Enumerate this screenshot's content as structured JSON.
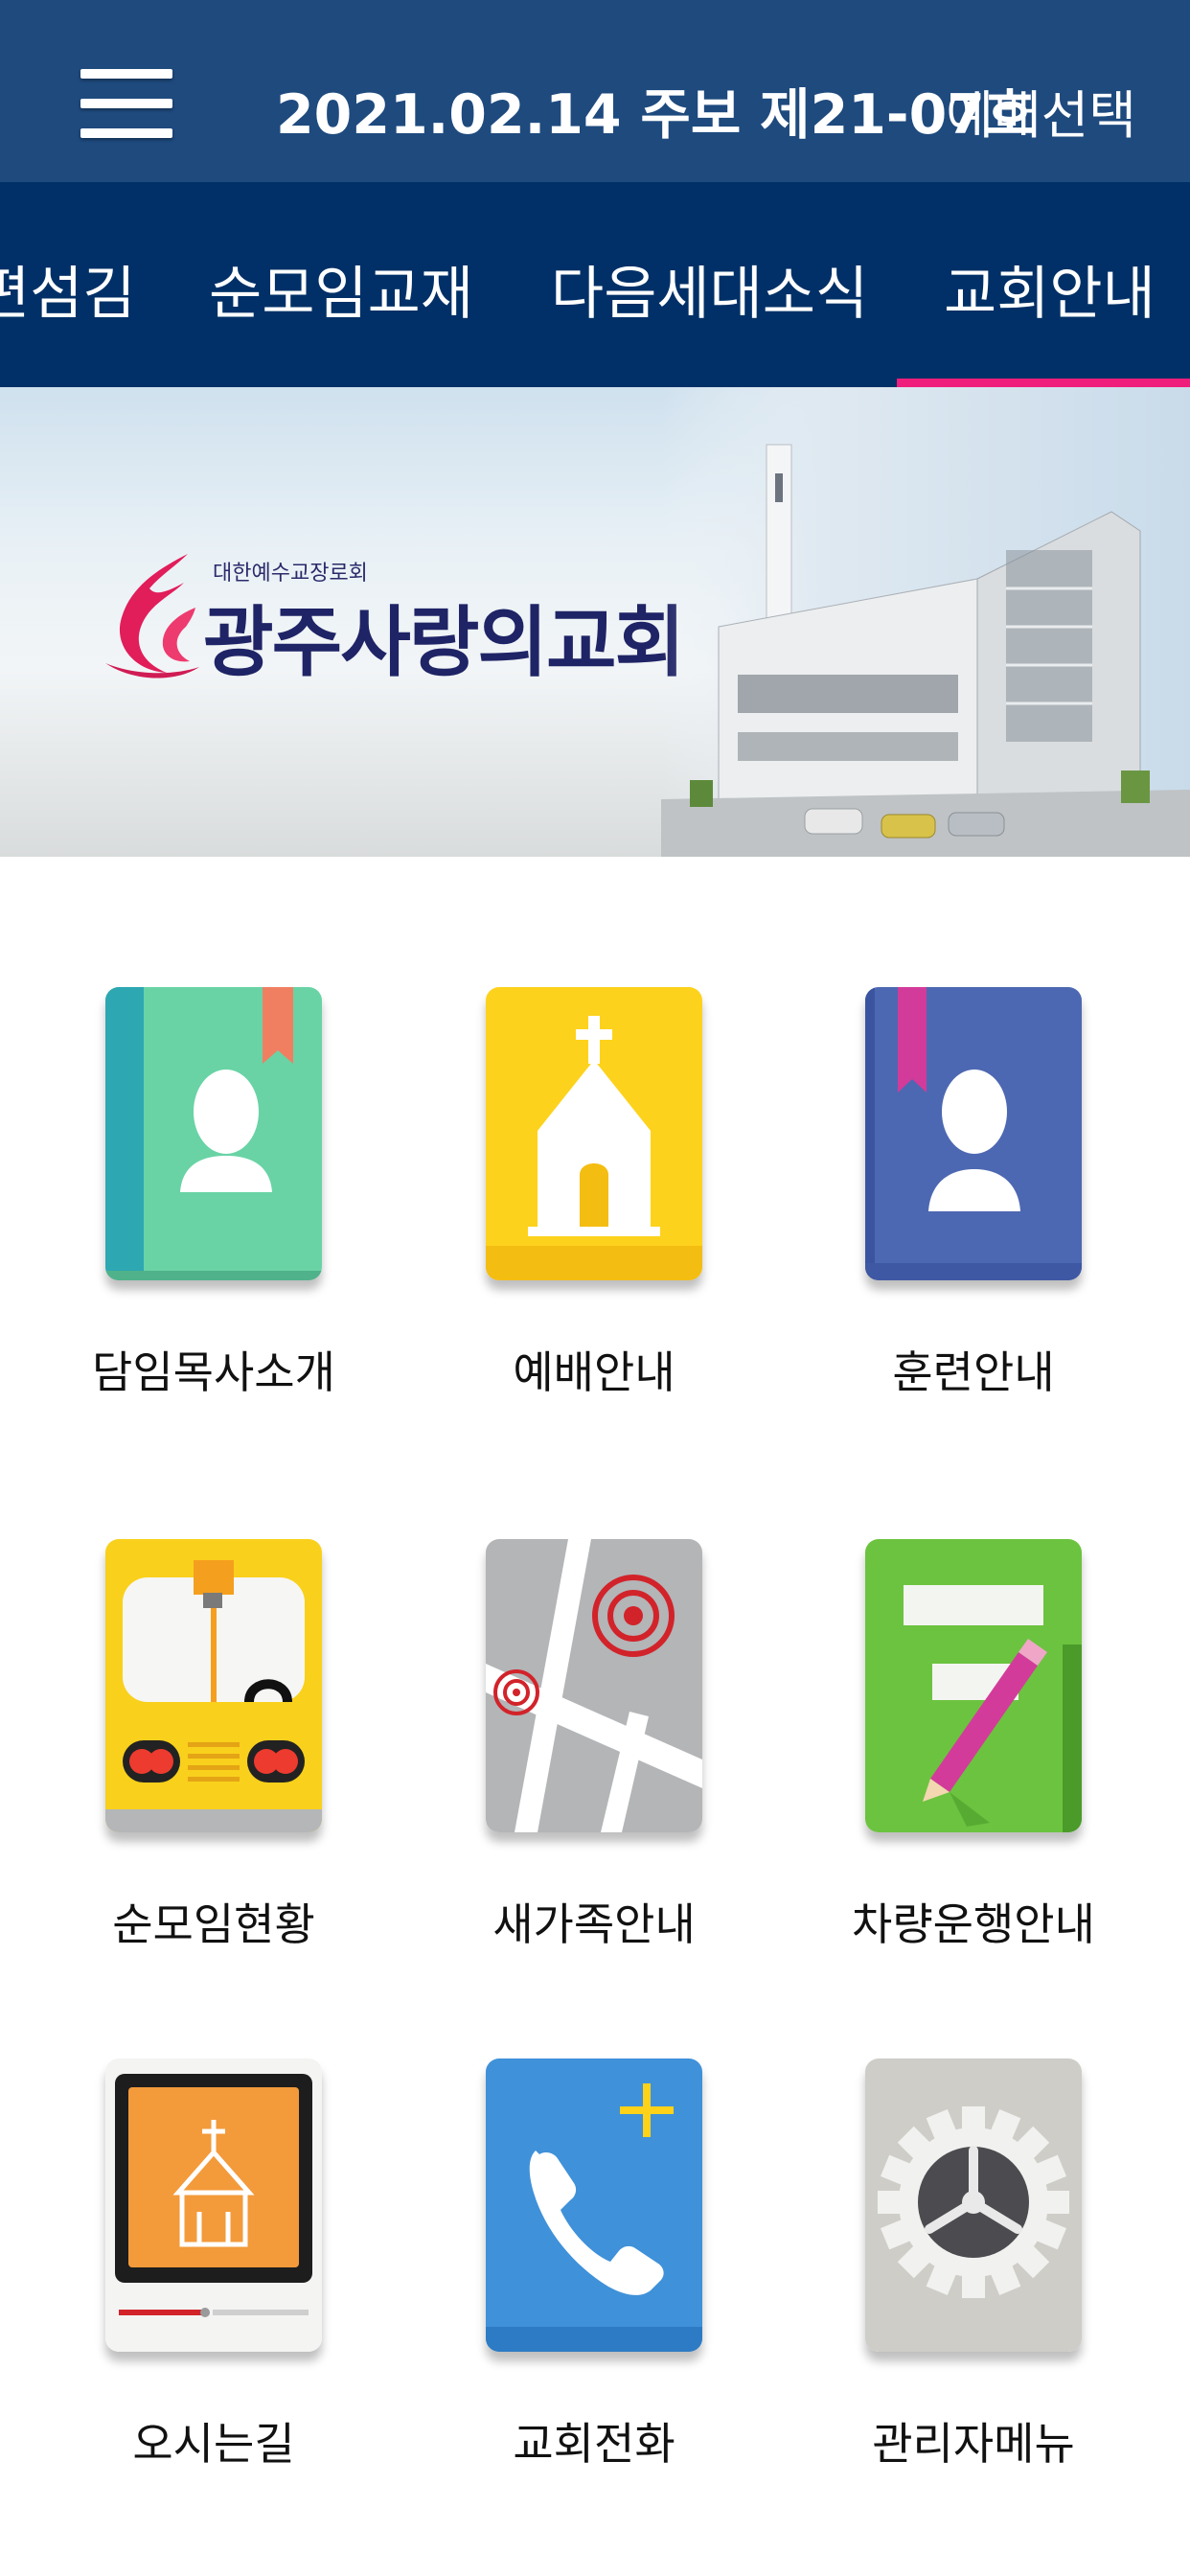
{
  "header": {
    "title": "2021.02.14 주보 제21-07호",
    "select_label": "예배선택"
  },
  "tabs": [
    {
      "label": "편섬김"
    },
    {
      "label": "순모임교재"
    },
    {
      "label": "다음세대소식"
    },
    {
      "label": "교회안내",
      "active": true
    }
  ],
  "banner": {
    "logo_small": "대한예수교장로회",
    "logo_name": "광주사랑의교회"
  },
  "grid": [
    {
      "label": "담임목사소개",
      "icon": "pastor-book-icon"
    },
    {
      "label": "예배안내",
      "icon": "church-icon"
    },
    {
      "label": "훈련안내",
      "icon": "training-book-icon"
    },
    {
      "label": "순모임현황",
      "icon": "bus-icon"
    },
    {
      "label": "새가족안내",
      "icon": "map-icon"
    },
    {
      "label": "차량운행안내",
      "icon": "notepad-pencil-icon"
    },
    {
      "label": "오시는길",
      "icon": "video-church-icon"
    },
    {
      "label": "교회전화",
      "icon": "phone-add-icon"
    },
    {
      "label": "관리자메뉴",
      "icon": "settings-gear-icon"
    }
  ],
  "colors": {
    "header_bg": "#1e4a7e",
    "tabs_bg": "#003067",
    "tab_indicator": "#ef1e7c"
  }
}
